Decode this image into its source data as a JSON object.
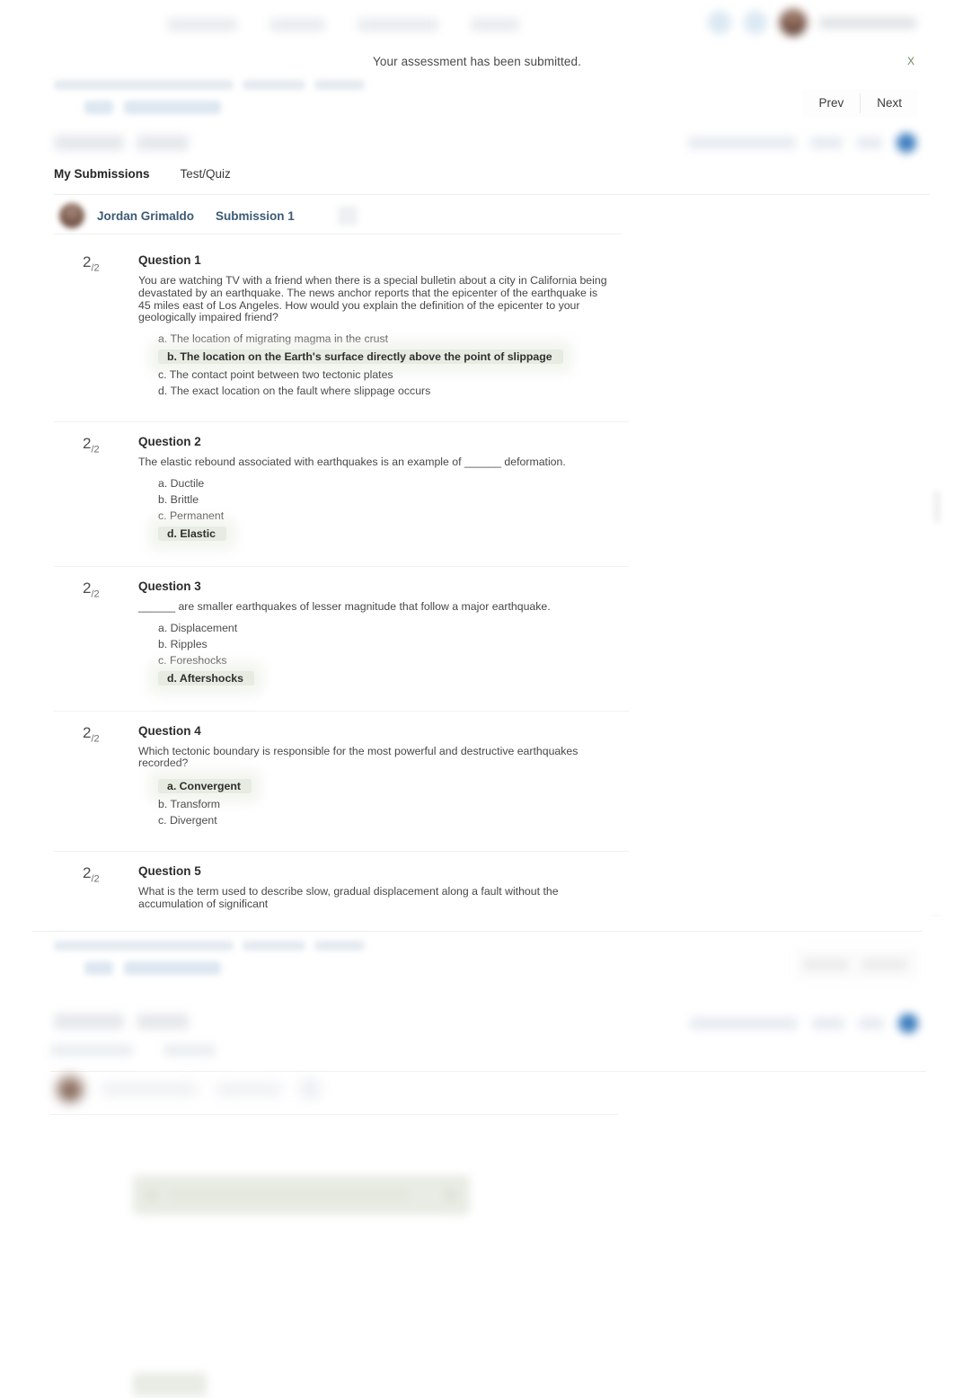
{
  "notice": {
    "message": "Your assessment has been submitted.",
    "close_label": "X"
  },
  "pager": {
    "prev_label": "Prev",
    "next_label": "Next"
  },
  "tabs": [
    {
      "label": "My Submissions",
      "active": true
    },
    {
      "label": "Test/Quiz",
      "active": false
    }
  ],
  "submission": {
    "student_name": "Jordan Grimaldo",
    "submission_label": "Submission 1"
  },
  "questions": [
    {
      "score": "2",
      "score_denominator": "/2",
      "title": "Question 1",
      "text": "You are watching TV with a friend when there is a special bulletin about a city in California being devastated by an earthquake. The news anchor reports that the epicenter of the earthquake is 45 miles east of Los Angeles. How would you explain the definition of the epicenter to your geologically impaired friend?",
      "options": [
        {
          "label": "a. The location of migrating magma in the crust",
          "selected": false
        },
        {
          "label": "b. The location on the Earth's surface directly above the point of slippage",
          "selected": true
        },
        {
          "label": "c. The contact point between two tectonic plates",
          "selected": false
        },
        {
          "label": "d. The exact location on the fault where slippage occurs",
          "selected": false
        }
      ]
    },
    {
      "score": "2",
      "score_denominator": "/2",
      "title": "Question 2",
      "text": "The elastic rebound associated with earthquakes is an example of ______ deformation.",
      "options": [
        {
          "label": "a. Ductile",
          "selected": false
        },
        {
          "label": "b. Brittle",
          "selected": false
        },
        {
          "label": "c. Permanent",
          "selected": false
        },
        {
          "label": "d. Elastic",
          "selected": true
        }
      ]
    },
    {
      "score": "2",
      "score_denominator": "/2",
      "title": "Question 3",
      "text": "______ are smaller earthquakes of lesser magnitude that follow a major earthquake.",
      "options": [
        {
          "label": "a. Displacement",
          "selected": false
        },
        {
          "label": "b. Ripples",
          "selected": false
        },
        {
          "label": "c. Foreshocks",
          "selected": false
        },
        {
          "label": "d. Aftershocks",
          "selected": true
        }
      ]
    },
    {
      "score": "2",
      "score_denominator": "/2",
      "title": "Question 4",
      "text": "Which tectonic boundary is responsible for the most powerful and destructive earthquakes recorded?",
      "options": [
        {
          "label": "a. Convergent",
          "selected": true
        },
        {
          "label": "b. Transform",
          "selected": false
        },
        {
          "label": "c. Divergent",
          "selected": false
        }
      ]
    },
    {
      "score": "2",
      "score_denominator": "/2",
      "title": "Question 5",
      "text": "What is the term used to describe slow, gradual displacement along a fault without the accumulation of significant",
      "options": []
    }
  ],
  "colors": {
    "selected_answer_bg": "#e7ece2",
    "link_text": "#3d5a75",
    "notice_close": "#6f8a5e",
    "accent_badge": "#3f7fbf"
  }
}
